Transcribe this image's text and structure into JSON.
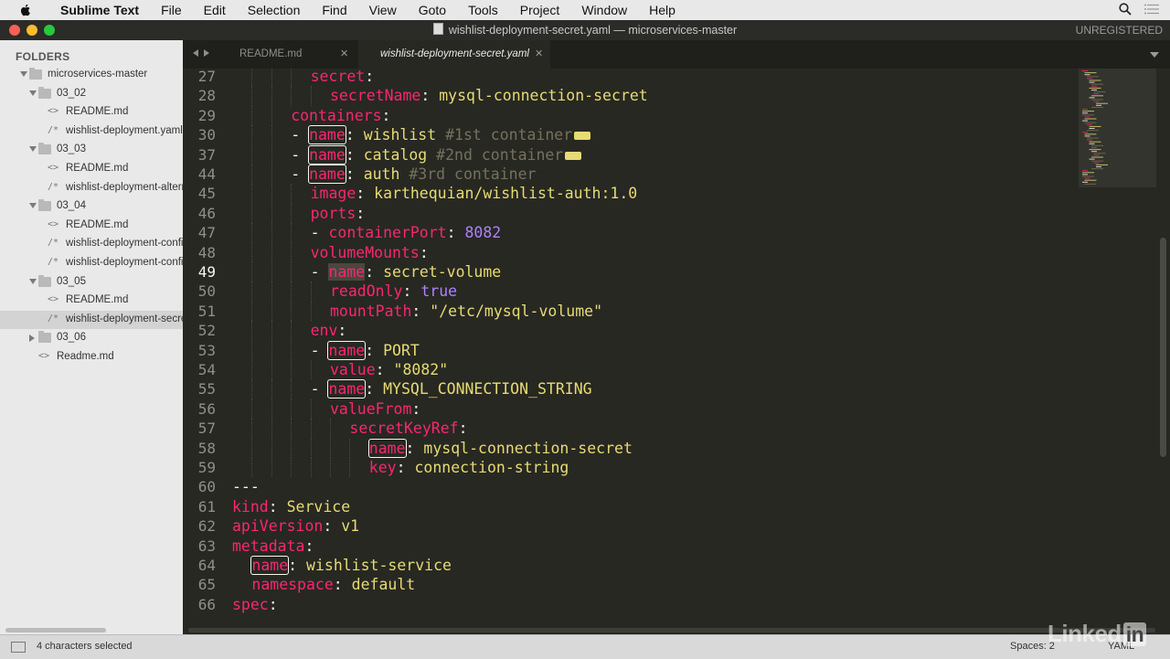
{
  "menubar": {
    "app": "Sublime Text",
    "items": [
      "File",
      "Edit",
      "Selection",
      "Find",
      "View",
      "Goto",
      "Tools",
      "Project",
      "Window",
      "Help"
    ]
  },
  "window": {
    "title": "wishlist-deployment-secret.yaml — microservices-master",
    "unregistered": "UNREGISTERED"
  },
  "sidebar": {
    "heading": "FOLDERS",
    "tree": [
      {
        "label": "microservices-master",
        "type": "folder",
        "depth": 1,
        "expanded": true
      },
      {
        "label": "03_02",
        "type": "folder",
        "depth": 2,
        "expanded": true
      },
      {
        "label": "README.md",
        "type": "file",
        "depth": 3,
        "icon": "<>"
      },
      {
        "label": "wishlist-deployment.yaml",
        "type": "file",
        "depth": 3,
        "icon": "/*"
      },
      {
        "label": "03_03",
        "type": "folder",
        "depth": 2,
        "expanded": true
      },
      {
        "label": "README.md",
        "type": "file",
        "depth": 3,
        "icon": "<>"
      },
      {
        "label": "wishlist-deployment-alternate.yaml",
        "type": "file",
        "depth": 3,
        "icon": "/*"
      },
      {
        "label": "03_04",
        "type": "folder",
        "depth": 2,
        "expanded": true
      },
      {
        "label": "README.md",
        "type": "file",
        "depth": 3,
        "icon": "<>"
      },
      {
        "label": "wishlist-deployment-configmap.yaml",
        "type": "file",
        "depth": 3,
        "icon": "/*"
      },
      {
        "label": "wishlist-deployment-configmap-env.yaml",
        "type": "file",
        "depth": 3,
        "icon": "/*"
      },
      {
        "label": "03_05",
        "type": "folder",
        "depth": 2,
        "expanded": true
      },
      {
        "label": "README.md",
        "type": "file",
        "depth": 3,
        "icon": "<>"
      },
      {
        "label": "wishlist-deployment-secret.yaml",
        "type": "file",
        "depth": 3,
        "icon": "/*",
        "selected": true
      },
      {
        "label": "03_06",
        "type": "folder",
        "depth": 2,
        "expanded": false
      },
      {
        "label": "Readme.md",
        "type": "file",
        "depth": 2,
        "icon": "<>"
      }
    ]
  },
  "tabs": [
    {
      "label": "README.md",
      "active": false
    },
    {
      "label": "wishlist-deployment-secret.yaml",
      "active": true
    }
  ],
  "editor": {
    "current_line": "49",
    "lines": [
      {
        "num": "27",
        "indent": 4,
        "tokens": [
          [
            "k",
            "secret"
          ],
          [
            "w",
            ":"
          ]
        ]
      },
      {
        "num": "28",
        "indent": 5,
        "tokens": [
          [
            "k",
            "secretName"
          ],
          [
            "w",
            ": "
          ],
          [
            "v",
            "mysql-connection-secret"
          ]
        ]
      },
      {
        "num": "29",
        "indent": 3,
        "tokens": [
          [
            "k",
            "containers"
          ],
          [
            "w",
            ":"
          ]
        ]
      },
      {
        "num": "30",
        "indent": 3,
        "tokens": [
          [
            "w",
            "- "
          ],
          [
            "kb",
            "name"
          ],
          [
            "w",
            ": "
          ],
          [
            "v",
            "wishlist "
          ],
          [
            "c",
            "#1st container"
          ],
          [
            "fold",
            ""
          ]
        ]
      },
      {
        "num": "37",
        "indent": 3,
        "tokens": [
          [
            "w",
            "- "
          ],
          [
            "kb",
            "name"
          ],
          [
            "w",
            ": "
          ],
          [
            "v",
            "catalog "
          ],
          [
            "c",
            "#2nd container"
          ],
          [
            "fold",
            ""
          ]
        ]
      },
      {
        "num": "44",
        "indent": 3,
        "tokens": [
          [
            "w",
            "- "
          ],
          [
            "kb",
            "name"
          ],
          [
            "w",
            ": "
          ],
          [
            "v",
            "auth "
          ],
          [
            "c",
            "#3rd container"
          ]
        ]
      },
      {
        "num": "45",
        "indent": 4,
        "tokens": [
          [
            "k",
            "image"
          ],
          [
            "w",
            ": "
          ],
          [
            "v",
            "karthequian/wishlist-auth:1.0"
          ]
        ]
      },
      {
        "num": "46",
        "indent": 4,
        "tokens": [
          [
            "k",
            "ports"
          ],
          [
            "w",
            ":"
          ]
        ]
      },
      {
        "num": "47",
        "indent": 4,
        "tokens": [
          [
            "w",
            "- "
          ],
          [
            "k",
            "containerPort"
          ],
          [
            "w",
            ": "
          ],
          [
            "n",
            "8082"
          ]
        ]
      },
      {
        "num": "48",
        "indent": 4,
        "tokens": [
          [
            "k",
            "volumeMounts"
          ],
          [
            "w",
            ":"
          ]
        ]
      },
      {
        "num": "49",
        "indent": 4,
        "tokens": [
          [
            "w",
            "- "
          ],
          [
            "ks",
            "name"
          ],
          [
            "w",
            ": "
          ],
          [
            "v",
            "secret-volume"
          ]
        ]
      },
      {
        "num": "50",
        "indent": 5,
        "tokens": [
          [
            "k",
            "readOnly"
          ],
          [
            "w",
            ": "
          ],
          [
            "n",
            "true"
          ]
        ]
      },
      {
        "num": "51",
        "indent": 5,
        "tokens": [
          [
            "k",
            "mountPath"
          ],
          [
            "w",
            ": "
          ],
          [
            "v",
            "\"/etc/mysql-volume\""
          ]
        ]
      },
      {
        "num": "52",
        "indent": 4,
        "tokens": [
          [
            "k",
            "env"
          ],
          [
            "w",
            ":"
          ]
        ]
      },
      {
        "num": "53",
        "indent": 4,
        "tokens": [
          [
            "w",
            "- "
          ],
          [
            "kb",
            "name"
          ],
          [
            "w",
            ": "
          ],
          [
            "v",
            "PORT"
          ]
        ]
      },
      {
        "num": "54",
        "indent": 5,
        "tokens": [
          [
            "k",
            "value"
          ],
          [
            "w",
            ": "
          ],
          [
            "v",
            "\"8082\""
          ]
        ]
      },
      {
        "num": "55",
        "indent": 4,
        "tokens": [
          [
            "w",
            "- "
          ],
          [
            "kb",
            "name"
          ],
          [
            "w",
            ": "
          ],
          [
            "v",
            "MYSQL_CONNECTION_STRING"
          ]
        ]
      },
      {
        "num": "56",
        "indent": 5,
        "tokens": [
          [
            "k",
            "valueFrom"
          ],
          [
            "w",
            ":"
          ]
        ]
      },
      {
        "num": "57",
        "indent": 6,
        "tokens": [
          [
            "k",
            "secretKeyRef"
          ],
          [
            "w",
            ":"
          ]
        ]
      },
      {
        "num": "58",
        "indent": 7,
        "tokens": [
          [
            "kb",
            "name"
          ],
          [
            "w",
            ": "
          ],
          [
            "v",
            "mysql-connection-secret"
          ]
        ]
      },
      {
        "num": "59",
        "indent": 7,
        "tokens": [
          [
            "k",
            "key"
          ],
          [
            "w",
            ": "
          ],
          [
            "v",
            "connection-string"
          ]
        ]
      },
      {
        "num": "60",
        "indent": 0,
        "tokens": [
          [
            "w",
            "---"
          ]
        ]
      },
      {
        "num": "61",
        "indent": 0,
        "tokens": [
          [
            "k",
            "kind"
          ],
          [
            "w",
            ": "
          ],
          [
            "v",
            "Service"
          ]
        ]
      },
      {
        "num": "62",
        "indent": 0,
        "tokens": [
          [
            "k",
            "apiVersion"
          ],
          [
            "w",
            ": "
          ],
          [
            "v",
            "v1"
          ]
        ]
      },
      {
        "num": "63",
        "indent": 0,
        "tokens": [
          [
            "k",
            "metadata"
          ],
          [
            "w",
            ":"
          ]
        ]
      },
      {
        "num": "64",
        "indent": 1,
        "tokens": [
          [
            "kb",
            "name"
          ],
          [
            "w",
            ": "
          ],
          [
            "v",
            "wishlist-service"
          ]
        ]
      },
      {
        "num": "65",
        "indent": 1,
        "tokens": [
          [
            "k",
            "namespace"
          ],
          [
            "w",
            ": "
          ],
          [
            "v",
            "default"
          ]
        ]
      },
      {
        "num": "66",
        "indent": 0,
        "tokens": [
          [
            "k",
            "spec"
          ],
          [
            "w",
            ":"
          ]
        ]
      }
    ]
  },
  "statusbar": {
    "selection": "4 characters selected",
    "spaces": "Spaces: 2",
    "syntax": "YAML"
  },
  "watermark": {
    "text": "Linked",
    "in": "in"
  },
  "colors": {
    "background": "#272822",
    "key": "#f92672",
    "string": "#e6db74",
    "number": "#ae81ff",
    "comment": "#75715e",
    "foreground": "#f8f8f2"
  }
}
